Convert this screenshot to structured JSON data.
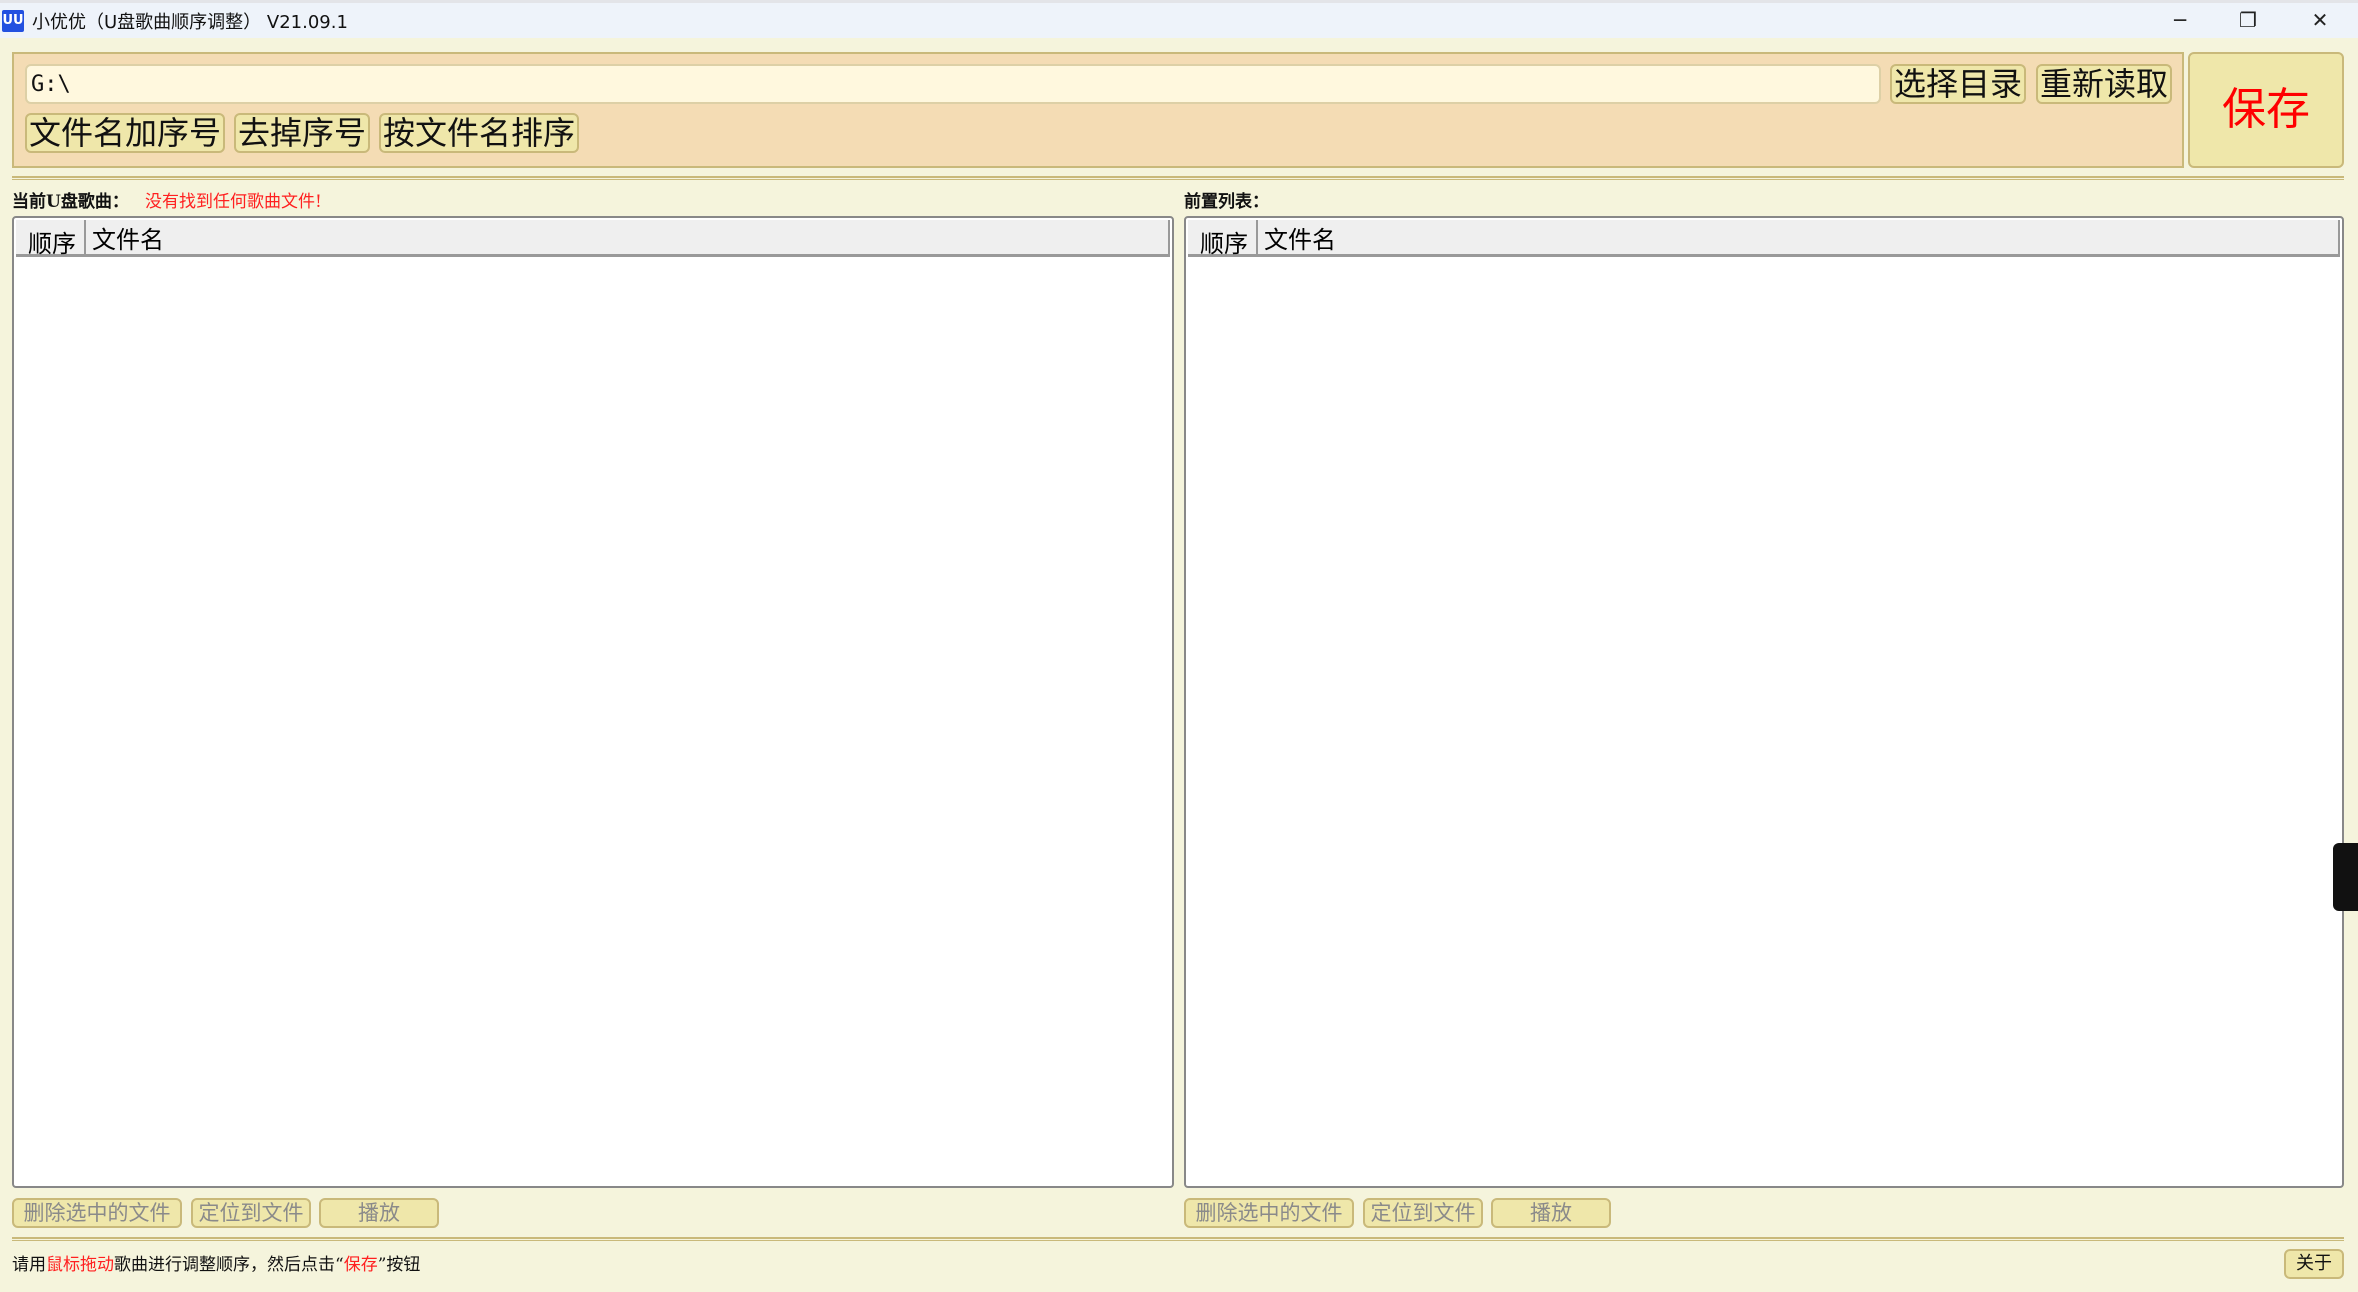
{
  "window": {
    "icon_text": "UU",
    "title": "小优优（U盘歌曲顺序调整） V21.09.1",
    "minimize": "─",
    "restore": "❐",
    "close": "✕"
  },
  "toolbar": {
    "path_value": "G:\\",
    "select_dir": "选择目录",
    "reload": "重新读取",
    "add_seq": "文件名加序号",
    "remove_seq": "去掉序号",
    "sort_by_name": "按文件名排序",
    "save": "保存"
  },
  "left": {
    "label": "当前U盘歌曲：",
    "message": "没有找到任何歌曲文件!",
    "columns": [
      "顺序",
      "文件名"
    ],
    "rows": [],
    "buttons": [
      "删除选中的文件",
      "定位到文件",
      "播放"
    ]
  },
  "right": {
    "label": "前置列表：",
    "columns": [
      "顺序",
      "文件名"
    ],
    "rows": [],
    "buttons": [
      "删除选中的文件",
      "定位到文件",
      "播放"
    ]
  },
  "status": {
    "p1": "请用",
    "p2": "鼠标拖动",
    "p3": "歌曲进行调整顺序，然后点击“",
    "p4": "保存",
    "p5": "”按钮"
  },
  "about": "关于",
  "colors": {
    "accent_red": "#ff0000",
    "panel": "#f4dcb4",
    "button": "#efe7aa",
    "background": "#f5f4dc"
  }
}
